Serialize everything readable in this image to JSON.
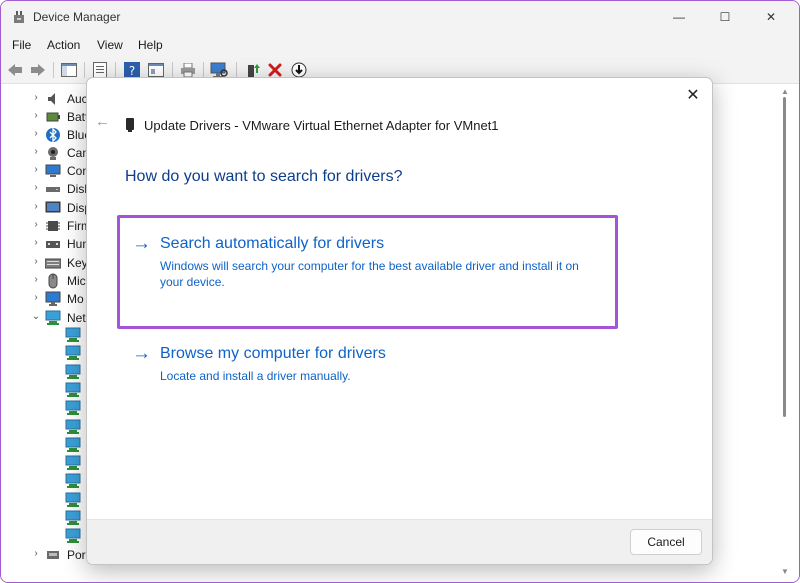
{
  "window": {
    "title": "Device Manager",
    "controls": {
      "minimize": "—",
      "maximize": "☐",
      "close": "✕"
    }
  },
  "menubar": {
    "items": [
      "File",
      "Action",
      "View",
      "Help"
    ]
  },
  "toolbar": {
    "buttons": [
      "back-icon",
      "forward-icon",
      "show-hide-tree-icon",
      "properties-icon",
      "help-icon",
      "view-icon",
      "print-icon",
      "scan-hardware-icon",
      "update-driver-icon",
      "uninstall-icon",
      "disable-icon"
    ]
  },
  "tree": {
    "categories": [
      {
        "label": "Auc",
        "icon": "audio-icon",
        "expanded": false
      },
      {
        "label": "Batt",
        "icon": "battery-icon",
        "expanded": false
      },
      {
        "label": "Blue",
        "icon": "bluetooth-icon",
        "expanded": false
      },
      {
        "label": "Can",
        "icon": "camera-icon",
        "expanded": false
      },
      {
        "label": "Con",
        "icon": "computer-icon",
        "expanded": false
      },
      {
        "label": "Disk",
        "icon": "disk-icon",
        "expanded": false
      },
      {
        "label": "Disp",
        "icon": "display-icon",
        "expanded": false
      },
      {
        "label": "Firm",
        "icon": "firmware-icon",
        "expanded": false
      },
      {
        "label": "Hun",
        "icon": "hid-icon",
        "expanded": false
      },
      {
        "label": "Key",
        "icon": "keyboard-icon",
        "expanded": false
      },
      {
        "label": "Mic",
        "icon": "mouse-icon",
        "expanded": false
      },
      {
        "label": "Mo",
        "icon": "monitor-icon",
        "expanded": false
      },
      {
        "label": "Net",
        "icon": "network-icon",
        "expanded": true
      }
    ],
    "network_children_count": 12,
    "last_category": {
      "label": "Por",
      "icon": "ports-icon",
      "expanded": false
    }
  },
  "dialog": {
    "close_label": "✕",
    "back_label": "←",
    "title": "Update Drivers - VMware Virtual Ethernet Adapter for VMnet1",
    "question": "How do you want to search for drivers?",
    "options": [
      {
        "arrow": "→",
        "title": "Search automatically for drivers",
        "description": "Windows will search your computer for the best available driver and install it on your device."
      },
      {
        "arrow": "→",
        "title": "Browse my computer for drivers",
        "description": "Locate and install a driver manually."
      }
    ],
    "cancel_label": "Cancel"
  },
  "colors": {
    "accent_blue": "#0e63c8",
    "heading_blue": "#0e3d8a",
    "highlight_purple": "#a554d8"
  }
}
